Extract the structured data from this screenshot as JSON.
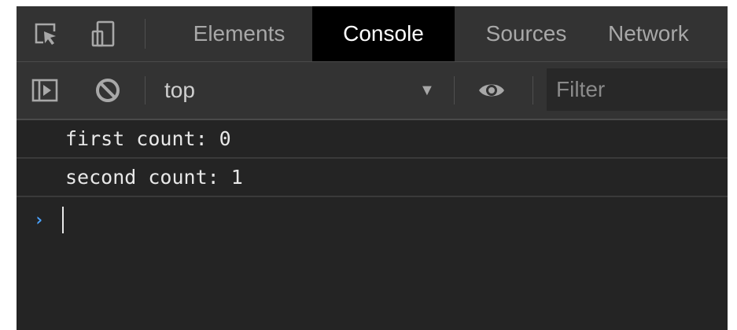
{
  "tabs": [
    {
      "label": "Elements",
      "active": false
    },
    {
      "label": "Console",
      "active": true
    },
    {
      "label": "Sources",
      "active": false
    },
    {
      "label": "Network",
      "active": false
    }
  ],
  "tab_icons": [
    "inspect-element-icon",
    "device-toolbar-icon"
  ],
  "toolbar": {
    "sidebar_icon": "show-console-sidebar-icon",
    "clear_icon": "clear-console-icon",
    "context": "top",
    "context_dropdown_icon": "dropdown-triangle-icon",
    "live_expression_icon": "eye-icon",
    "filter_placeholder": "Filter"
  },
  "console": {
    "messages": [
      {
        "text": "first count: 0"
      },
      {
        "text": "second count: 1"
      }
    ],
    "prompt_symbol": "›"
  },
  "colors": {
    "panel_bg": "#242424",
    "toolbar_bg": "#333333",
    "active_tab_bg": "#000000",
    "prompt_accent": "#4aa3ff"
  }
}
